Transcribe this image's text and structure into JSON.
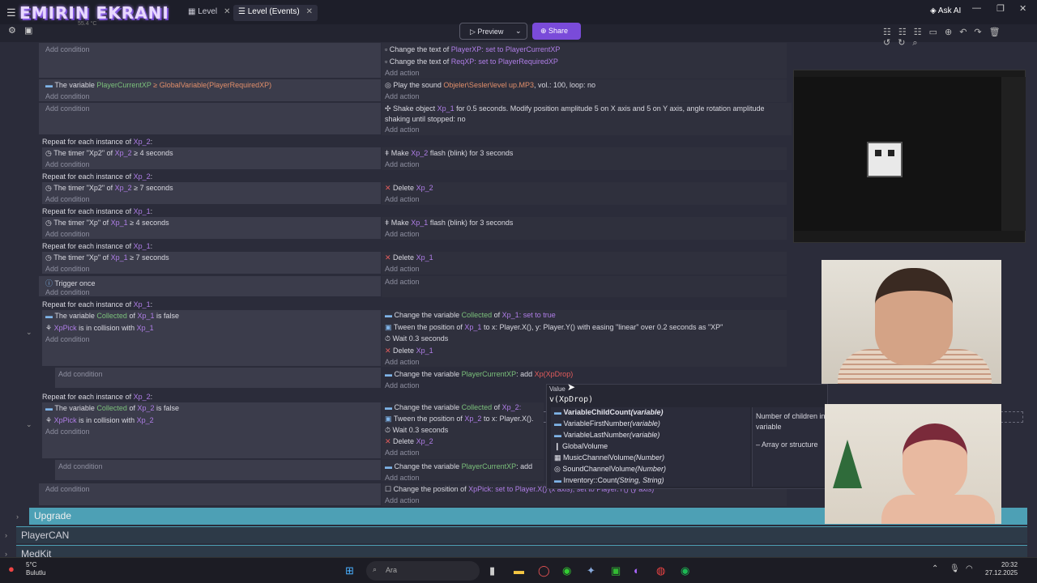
{
  "window": {
    "logo_text": "EMIRIN EKRANI",
    "tabs": [
      {
        "label": "Level",
        "active": false
      },
      {
        "label": "Level (Events)",
        "active": true
      }
    ],
    "ask_ai": "Ask AI",
    "fps": "55.4 °C"
  },
  "toolbar": {
    "preview_label": "Preview",
    "share_label": "Share"
  },
  "rows": [
    {
      "cond_add": "Add condition",
      "act1": "Change the text of",
      "act1_obj": "PlayerXP",
      "act1_rest": ": set to",
      "act1_val": "PlayerCurrentXP",
      "act2": "Change the text of",
      "act2_obj": "ReqXP",
      "act2_rest": ": set to",
      "act2_val": "PlayerRequiredXP",
      "act_add": "Add action"
    },
    {
      "cond1": "The variable",
      "cond1_var": "PlayerCurrentXP",
      "cond1_rest": "≥ GlobalVariable(PlayerRequiredXP)",
      "cond_add": "Add condition",
      "act1": "Play the sound",
      "act1_val": "Objeler\\Sesler\\level up.MP3",
      "act1_rest": ", vol.: 100, loop: no",
      "act_add": "Add action"
    },
    {
      "cond_add": "Add condition",
      "act1": "Shake object",
      "act1_obj": "Xp_1",
      "act1_rest": "for 0.5 seconds. Modify position amplitude 5 on X axis and 5 on Y axis, angle rotation amplitude",
      "act2": "shaking until stopped: no",
      "act_add": "Add action"
    }
  ],
  "repeat_blocks": [
    {
      "label": "Repeat for each instance of",
      "obj": "Xp_2",
      "cond": "The timer \"Xp2\" of",
      "cond_obj": "Xp_2",
      "cond_rest": "≥ 4 seconds",
      "act": "Make",
      "act_obj": "Xp_2",
      "act_rest": "flash (blink) for 3 seconds"
    },
    {
      "label": "Repeat for each instance of",
      "obj": "Xp_2",
      "cond": "The timer \"Xp2\" of",
      "cond_obj": "Xp_2",
      "cond_rest": "≥ 7 seconds",
      "act": "Delete",
      "act_obj": "Xp_2",
      "act_rest": ""
    },
    {
      "label": "Repeat for each instance of",
      "obj": "Xp_1",
      "cond": "The timer \"Xp\" of",
      "cond_obj": "Xp_1",
      "cond_rest": "≥ 4 seconds",
      "act": "Make",
      "act_obj": "Xp_1",
      "act_rest": "flash (blink) for 3 seconds"
    },
    {
      "label": "Repeat for each instance of",
      "obj": "Xp_1",
      "cond": "The timer \"Xp\" of",
      "cond_obj": "Xp_1",
      "cond_rest": "≥ 7 seconds",
      "act": "Delete",
      "act_obj": "Xp_1",
      "act_rest": ""
    }
  ],
  "trigger_once": "Trigger once",
  "collect1": {
    "label": "Repeat for each instance of",
    "obj": "Xp_1",
    "cond1": "The variable",
    "cond1_var": "Collected",
    "cond1_of": "of",
    "cond1_obj": "Xp_1",
    "cond1_rest": "is false",
    "cond2_obj": "XpPick",
    "cond2_rest": "is in collision with",
    "cond2_obj2": "Xp_1",
    "act1": "Change the variable",
    "act1_var": "Collected",
    "act1_of": "of",
    "act1_obj": "Xp_1",
    "act1_rest": ": set to true",
    "act2": "Tween the position of",
    "act2_obj": "Xp_1",
    "act2_rest": "to x: Player.X(), y: Player.Y() with easing \"linear\" over 0.2 seconds as \"XP\"",
    "act3": "Wait 0.3 seconds",
    "act4": "Delete",
    "act4_obj": "Xp_1",
    "sub_act": "Change the variable",
    "sub_var": "PlayerCurrentXP",
    "sub_rest": ": add",
    "sub_val": "Xp(XpDrop)"
  },
  "collect2": {
    "label": "Repeat for each instance of",
    "obj": "Xp_2",
    "cond1": "The variable",
    "cond1_var": "Collected",
    "cond1_of": "of",
    "cond1_obj": "Xp_2",
    "cond1_rest": "is false",
    "cond2_obj": "XpPick",
    "cond2_rest": "is in collision with",
    "cond2_obj2": "Xp_2",
    "act1": "Change the variable",
    "act1_var": "Collected",
    "act1_of": "of",
    "act1_obj": "Xp_2:",
    "act2": "Tween the position of",
    "act2_obj": "Xp_2",
    "act2_rest": "to x: Player.X().",
    "act3": "Wait 0.3 seconds",
    "act4": "Delete",
    "act4_obj": "Xp_2",
    "sub_act": "Change the variable",
    "sub_var": "PlayerCurrentXP",
    "sub_rest": ": add"
  },
  "last_row": {
    "act": "Change the position of",
    "act_obj": "XpPick",
    "act_rest": ": set to Player.X() (x axis), set to Player.Y() (y axis)"
  },
  "common": {
    "add_condition": "Add condition",
    "add_action": "Add action"
  },
  "groups": [
    "Upgrade",
    "PlayerCAN",
    "MedKit"
  ],
  "autocomplete": {
    "label": "Value",
    "input": "v(XpDrop)",
    "items": [
      {
        "name": "VariableChildCount",
        "args": "(variable)"
      },
      {
        "name": "VariableFirstNumber",
        "args": "(variable)"
      },
      {
        "name": "VariableLastNumber",
        "args": "(variable)"
      },
      {
        "name": "GlobalVolume",
        "args": ""
      },
      {
        "name": "MusicChannelVolume",
        "args": "(Number)"
      },
      {
        "name": "SoundChannelVolume",
        "args": "(Number)"
      },
      {
        "name": "Inventory::Count",
        "args": "(String, String)"
      }
    ],
    "desc1": "Number of children in",
    "desc2": "variable",
    "desc3": "– Array or structure"
  },
  "taskbar": {
    "temp": "5°C",
    "weather": "Bulutlu",
    "search": "Ara",
    "time": "20:32",
    "date": "27.12.2025"
  }
}
